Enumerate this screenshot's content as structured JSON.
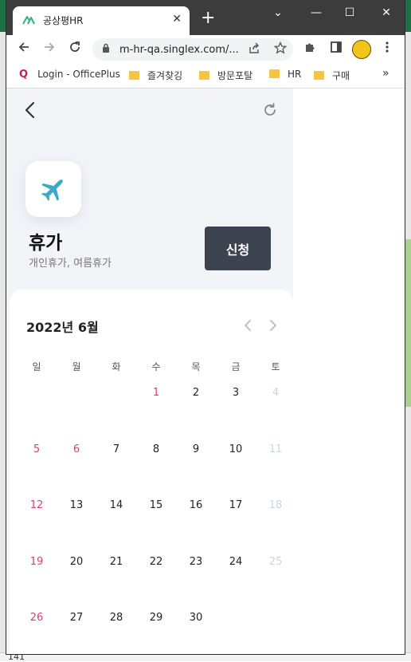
{
  "browser": {
    "tab_title": "공상평HR",
    "tab_close": "✕",
    "new_tab": "+",
    "url": "m-hr-qa.singlex.com/...",
    "window_controls": {
      "minimize": "—",
      "maximize": "☐",
      "close": "✕",
      "dropdown": "⌄"
    }
  },
  "bookmarks": {
    "items": [
      {
        "label": "Login - OfficePlus",
        "icon": "officeplus-icon"
      },
      {
        "label": "즐겨찾깅",
        "icon": "folder-icon"
      },
      {
        "label": "방문포탈",
        "icon": "folder-icon"
      },
      {
        "label": "HR",
        "icon": "folder-icon"
      },
      {
        "label": "구매",
        "icon": "folder-icon"
      }
    ],
    "overflow": "»"
  },
  "page": {
    "title": "휴가",
    "subtitle": "개인휴가, 여름휴가",
    "apply_label": "신청",
    "accent": "#3ca9c9"
  },
  "calendar": {
    "month_label": "2022년 6월",
    "weekdays": [
      "일",
      "월",
      "화",
      "수",
      "목",
      "금",
      "토"
    ],
    "weeks": [
      [
        "",
        "",
        "",
        "1",
        "2",
        "3",
        "4"
      ],
      [
        "5",
        "6",
        "7",
        "8",
        "9",
        "10",
        "11"
      ],
      [
        "12",
        "13",
        "14",
        "15",
        "16",
        "17",
        "18"
      ],
      [
        "19",
        "20",
        "21",
        "22",
        "23",
        "24",
        "25"
      ],
      [
        "26",
        "27",
        "28",
        "29",
        "30",
        "",
        ""
      ]
    ],
    "holidays": [
      "1",
      "6"
    ],
    "colors": {
      "sunday": "#d43f7a",
      "saturday": "#c7d5e8",
      "weekday": "#222222"
    }
  },
  "background": {
    "row_number": "141"
  }
}
